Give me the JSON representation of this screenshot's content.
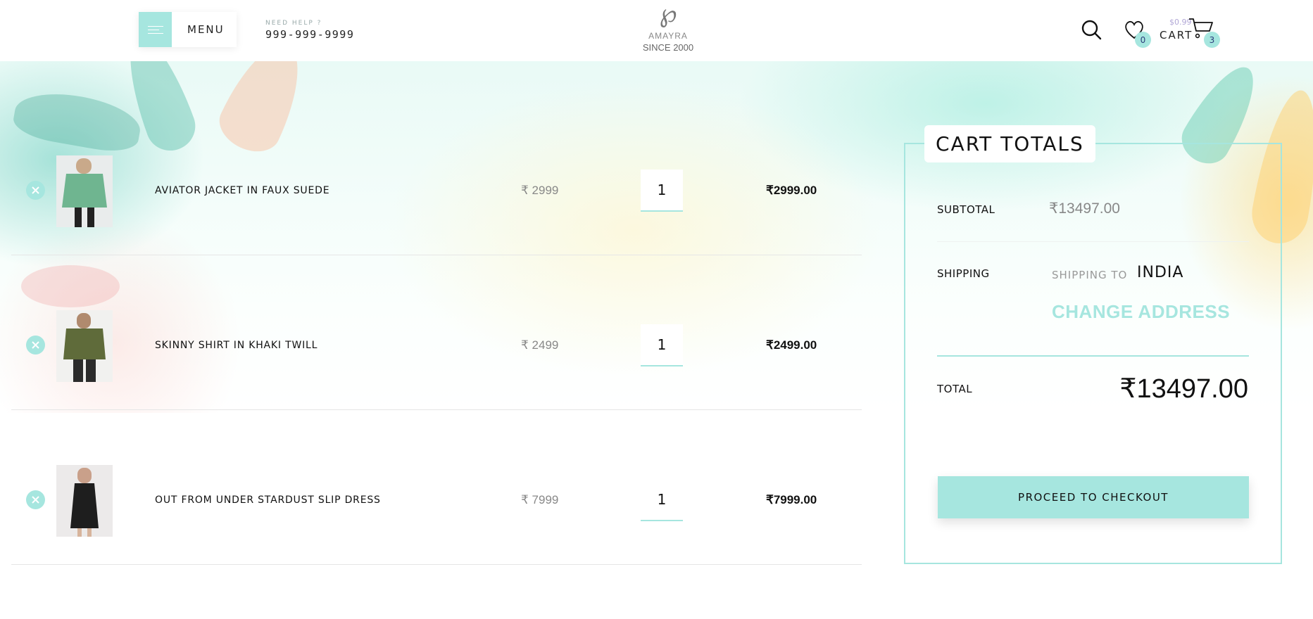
{
  "header": {
    "menu_label": "MENU",
    "help_label": "NEED HELP ?",
    "help_phone": "999-999-9999",
    "logo_name": "AMAYRA",
    "logo_since": "SINCE 2000",
    "wishlist_count": "0",
    "cart_price": "$0.99",
    "cart_label": "CART",
    "cart_count": "3"
  },
  "items": [
    {
      "name": "AVIATOR JACKET IN FAUX SUEDE",
      "price": "₹ 2999",
      "qty": "1",
      "total": "₹2999.00"
    },
    {
      "name": "SKINNY SHIRT IN KHAKI TWILL",
      "price": "₹ 2499",
      "qty": "1",
      "total": "₹2499.00"
    },
    {
      "name": "OUT FROM UNDER STARDUST SLIP DRESS",
      "price": "₹ 7999",
      "qty": "1",
      "total": "₹7999.00"
    }
  ],
  "totals": {
    "title": "CART TOTALS",
    "subtotal_label": "SUBTOTAL",
    "subtotal_value": "₹13497.00",
    "shipping_label": "SHIPPING",
    "shipping_to": "SHIPPING TO",
    "country": "INDIA",
    "change_address": "CHANGE ADDRESS",
    "total_label": "TOTAL",
    "total_value": "₹13497.00",
    "checkout_label": "PROCEED TO CHECKOUT"
  },
  "colors": {
    "accent": "#a6e6df",
    "text": "#111111",
    "muted": "#888888"
  }
}
